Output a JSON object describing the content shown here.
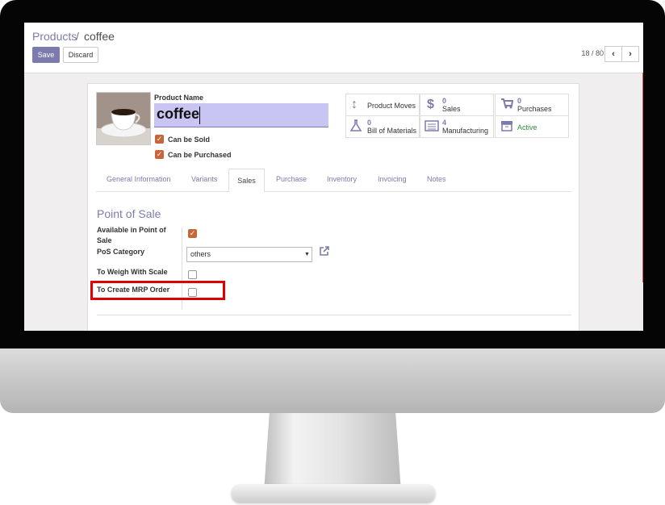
{
  "breadcrumb": {
    "parent": "Products",
    "separator": "/",
    "current": "coffee"
  },
  "toolbar": {
    "save_label": "Save",
    "discard_label": "Discard"
  },
  "pager": {
    "value": "18 / 80",
    "prev_icon": "chevron-left-icon",
    "next_icon": "chevron-right-icon"
  },
  "product": {
    "name_label": "Product Name",
    "name_value": "coffee",
    "image_icon": "coffee-cup-image",
    "can_be_sold": {
      "label": "Can be Sold",
      "checked": true
    },
    "can_be_purchased": {
      "label": "Can be Purchased",
      "checked": true
    }
  },
  "stat_buttons": [
    {
      "count": "",
      "label": "Product Moves",
      "icon": "arrows-vertical-icon"
    },
    {
      "count": "0",
      "label": "Sales",
      "icon": "dollar-icon"
    },
    {
      "count": "0",
      "label": "Purchases",
      "icon": "cart-icon"
    },
    {
      "count": "0",
      "label": "Bill of Materials",
      "icon": "flask-icon"
    },
    {
      "count": "4",
      "label": "Manufacturing",
      "icon": "list-icon"
    },
    {
      "count": "",
      "label": "Active",
      "icon": "archive-icon",
      "color": "#2f8c3a"
    }
  ],
  "tabs": [
    "General Information",
    "Variants",
    "Sales",
    "Purchase",
    "Inventory",
    "Invoicing",
    "Notes"
  ],
  "active_tab": "Sales",
  "section_title": "Point of Sale",
  "fields": {
    "available_pos": {
      "label_line1": "Available in Point of",
      "label_line2": "Sale",
      "checked": true
    },
    "pos_category": {
      "label": "PoS Category",
      "value": "others"
    },
    "to_weigh": {
      "label": "To Weigh With Scale",
      "checked": false
    },
    "mrp_order": {
      "label": "To Create MRP Order",
      "checked": false,
      "highlight_color": "#e00000"
    }
  },
  "colors": {
    "accent": "#7c7bad",
    "checkbox": "#c8663a",
    "input_bg": "#c9c5f2",
    "highlight": "#e00000"
  }
}
